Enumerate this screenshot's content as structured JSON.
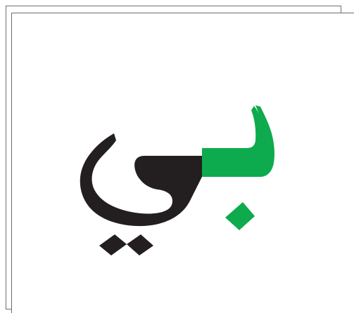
{
  "logo": {
    "glyph_text": "بي",
    "colors": {
      "green": "#0dab4d",
      "black": "#231f20",
      "frame": "#6e6e6e",
      "background": "#ffffff"
    }
  }
}
